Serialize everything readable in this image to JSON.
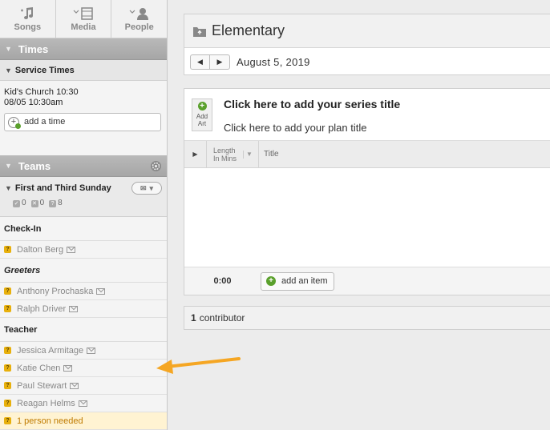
{
  "nav": {
    "songs": "Songs",
    "media": "Media",
    "people": "People"
  },
  "times": {
    "heading": "Times",
    "service_times_label": "Service Times",
    "service_name": "Kid's Church 10:30",
    "service_datetime": "08/05 10:30am",
    "add_time_label": "add a time"
  },
  "teams": {
    "heading": "Teams",
    "team_name": "First and Third Sunday",
    "counts": {
      "confirmed": "0",
      "declined": "0",
      "unconfirmed": "8"
    },
    "positions": [
      {
        "name": "Check-In",
        "people": [
          "Dalton Berg"
        ]
      },
      {
        "name": "Greeters",
        "people": [
          "Anthony Prochaska",
          "Ralph Driver"
        ]
      },
      {
        "name": "Teacher",
        "people": [
          "Jessica Armitage",
          "Katie Chen",
          "Paul Stewart",
          "Reagan Helms"
        ]
      }
    ],
    "needed_text": "1 person needed"
  },
  "plan": {
    "title": "Elementary",
    "date": "August 5, 2019",
    "add_art_label_1": "Add",
    "add_art_label_2": "Art",
    "series_title": "Click here to add your series title",
    "plan_title": "Click here to add your plan title",
    "col_length_1": "Length",
    "col_length_2": "In Mins",
    "col_title": "Title",
    "total_time": "0:00",
    "add_item_label": "add an item"
  },
  "contributors": {
    "count": "1",
    "label": "contributor"
  },
  "colors": {
    "accent_green": "#5aa02c",
    "badge_yellow": "#e8b00c",
    "annotation_arrow": "#f5a623"
  }
}
